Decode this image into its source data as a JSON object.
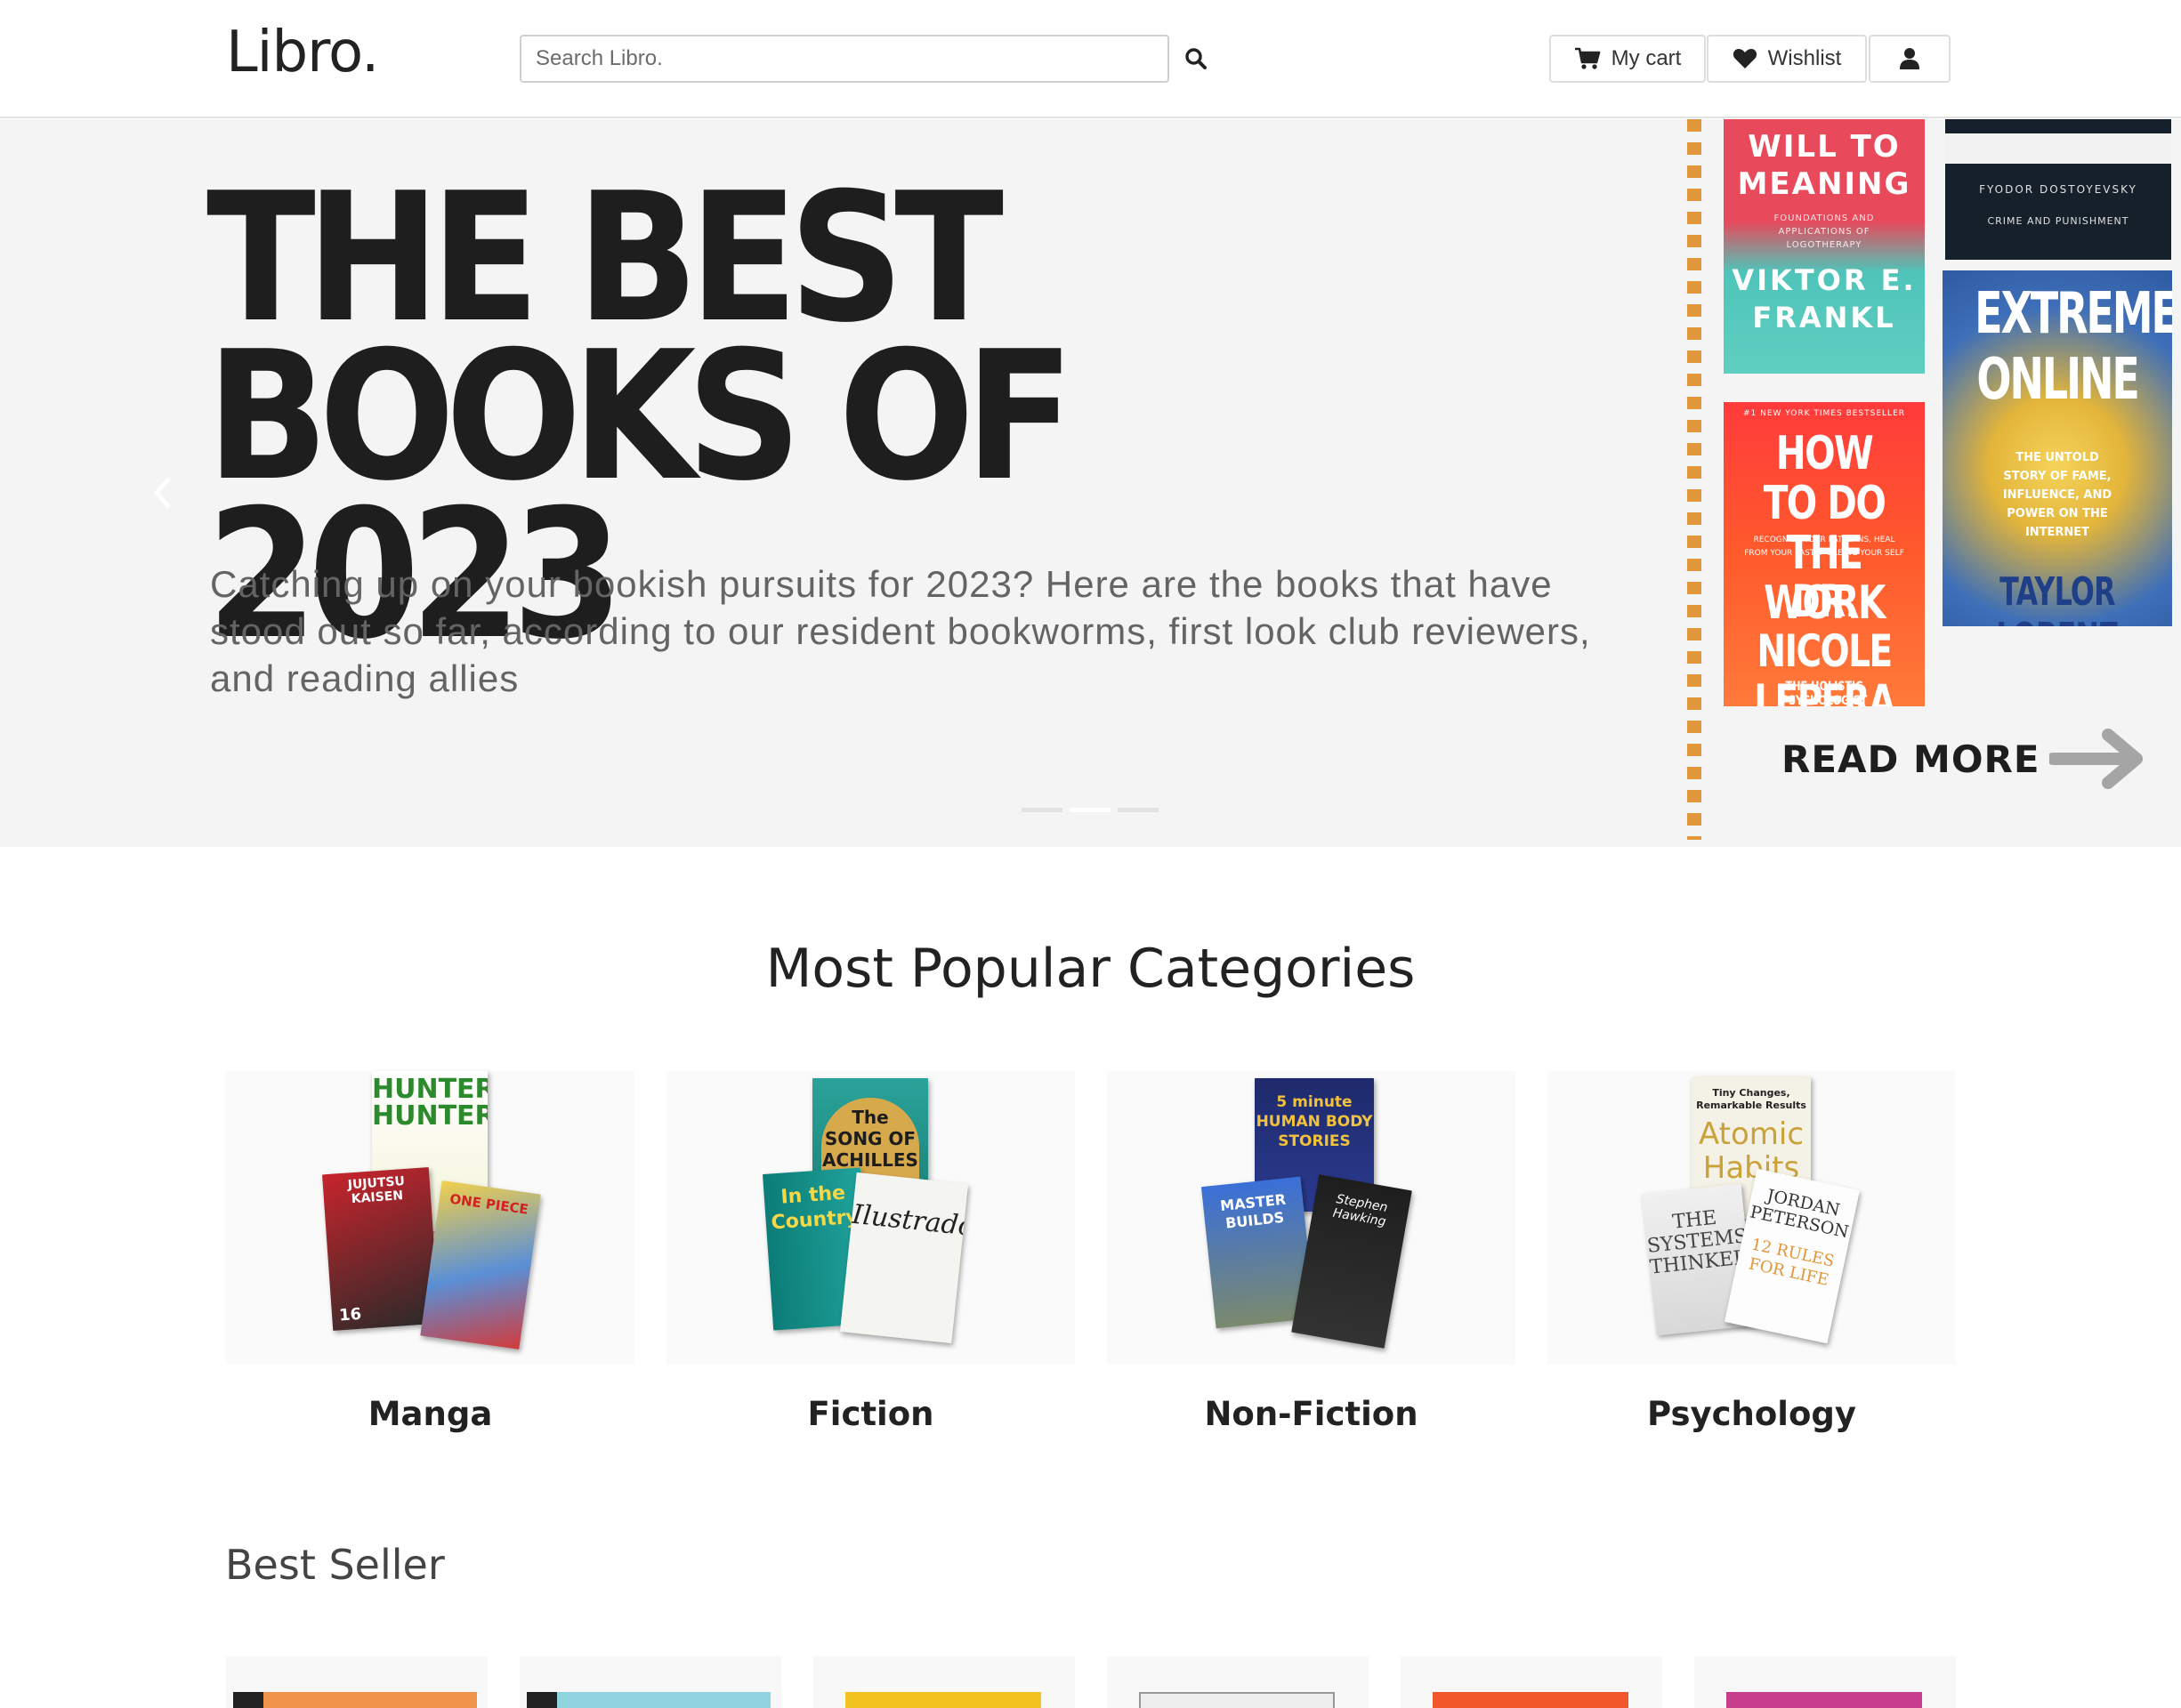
{
  "header": {
    "logo": "Libro.",
    "search_placeholder": "Search Libro.",
    "cart_label": "My cart",
    "wishlist_label": "Wishlist"
  },
  "hero": {
    "title": "THE BEST BOOKS OF 2023",
    "text": "Catching up on your bookish pursuits for 2023? Here are the books that have stood out so far, according to our resident bookworms, first look club reviewers, and reading allies",
    "read_more": "READ MORE",
    "active_slide": 2,
    "slide_count": 3,
    "covers": {
      "will_to_meaning": {
        "title": "WILL TO MEANING",
        "subtitle": "FOUNDATIONS AND APPLICATIONS OF LOGOTHERAPY",
        "author": "VIKTOR E. FRANKL"
      },
      "crime": {
        "author": "FYODOR DOSTOYEVSKY",
        "title": "CRIME AND PUNISHMENT"
      },
      "how_to_do": {
        "top": "#1 NEW YORK TIMES BESTSELLER",
        "title": "HOW TO DO THE WORK",
        "subtitle": "RECOGNIZE YOUR PATTERNS, HEAL FROM YOUR PAST + CREATE YOUR SELF",
        "author": "DR. NICOLE LEPERA",
        "tagline": "THE HOLISTIC PSYCHOLOGIST"
      },
      "extremely_online": {
        "title": "EXTREMELY ONLINE",
        "subtitle": "THE UNTOLD STORY OF FAME, INFLUENCE, AND POWER ON THE INTERNET",
        "author": "TAYLOR LORENZ"
      }
    }
  },
  "categories": {
    "heading": "Most Popular Categories",
    "items": [
      {
        "label": "Manga"
      },
      {
        "label": "Fiction"
      },
      {
        "label": "Non-Fiction"
      },
      {
        "label": "Psychology"
      }
    ],
    "covers": {
      "hunter": "HUNTER HUNTER",
      "jujutsu": "JUJUTSU KAISEN",
      "jujutsu_vol": "16",
      "onepiece": "ONE PIECE",
      "achilles": "The SONG OF ACHILLES",
      "country": "In the Country",
      "illustrado": "Ilustrado",
      "human_body": "5 minute HUMAN BODY STORIES",
      "master_builds": "MASTER BUILDS",
      "stephen": "Stephen Hawking",
      "atomic": "Atomic Habits",
      "atomic_top": "Tiny Changes, Remarkable Results",
      "systems": "THE SYSTEMS THINKER",
      "rules_author": "JORDAN PETERSON",
      "rules": "12 RULES FOR LIFE"
    }
  },
  "best_seller": {
    "heading": "Best Seller",
    "cover_colors": [
      "#f0934a",
      "#8fd3e0",
      "#f2c21e",
      "#eeeeee",
      "#f2562b",
      "#c93d8d"
    ]
  },
  "colors": {
    "accent_dashes": "#e0963a",
    "hero_bg": "#f4f4f4",
    "text_dark": "#1e1e1e"
  }
}
